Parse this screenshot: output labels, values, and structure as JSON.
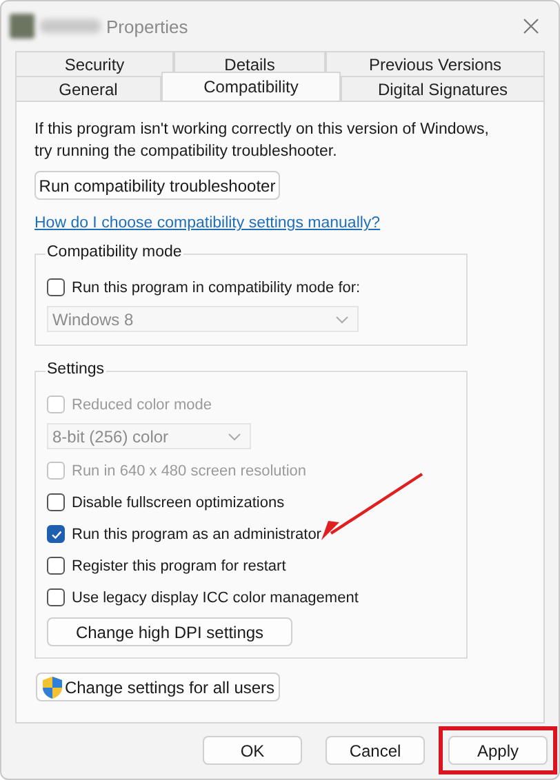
{
  "window": {
    "title": "Properties"
  },
  "tab_rows": [
    [
      {
        "label": "Security",
        "selected": false
      },
      {
        "label": "Details",
        "selected": false
      },
      {
        "label": "Previous Versions",
        "selected": false
      }
    ],
    [
      {
        "label": "General",
        "selected": false
      },
      {
        "label": "Compatibility",
        "selected": true
      },
      {
        "label": "Digital Signatures",
        "selected": false
      }
    ]
  ],
  "intro": "If this program isn't working correctly on this version of Windows, try running the compatibility troubleshooter.",
  "troubleshooter_button": "Run compatibility troubleshooter",
  "help_link": "How do I choose compatibility settings manually?",
  "compatibility_mode": {
    "title": "Compatibility mode",
    "items": [
      {
        "kind": "checkbox",
        "label": "Run this program in compatibility mode for:",
        "checked": false,
        "disabled": false,
        "pointed": false
      },
      {
        "kind": "dropdown",
        "label": "Windows 8",
        "disabled": true,
        "wide": true
      }
    ]
  },
  "settings": {
    "title": "Settings",
    "items": [
      {
        "kind": "checkbox",
        "label": "Reduced color mode",
        "checked": false,
        "disabled": true,
        "pointed": false
      },
      {
        "kind": "dropdown",
        "label": "8-bit (256) color",
        "disabled": true,
        "wide": false
      },
      {
        "kind": "checkbox",
        "label": "Run in 640 x 480 screen resolution",
        "checked": false,
        "disabled": true,
        "pointed": false
      },
      {
        "kind": "checkbox",
        "label": "Disable fullscreen optimizations",
        "checked": false,
        "disabled": false,
        "pointed": false
      },
      {
        "kind": "checkbox",
        "label": "Run this program as an administrator",
        "checked": true,
        "disabled": false,
        "pointed": true
      },
      {
        "kind": "checkbox",
        "label": "Register this program for restart",
        "checked": false,
        "disabled": false,
        "pointed": false
      },
      {
        "kind": "checkbox",
        "label": "Use legacy display ICC color management",
        "checked": false,
        "disabled": false,
        "pointed": false
      },
      {
        "kind": "button",
        "label": "Change high DPI settings"
      }
    ]
  },
  "all_users_button": "Change settings for all users",
  "footer_buttons": [
    {
      "label": "OK",
      "highlighted": false
    },
    {
      "label": "Cancel",
      "highlighted": false
    },
    {
      "label": "Apply",
      "highlighted": true
    }
  ]
}
